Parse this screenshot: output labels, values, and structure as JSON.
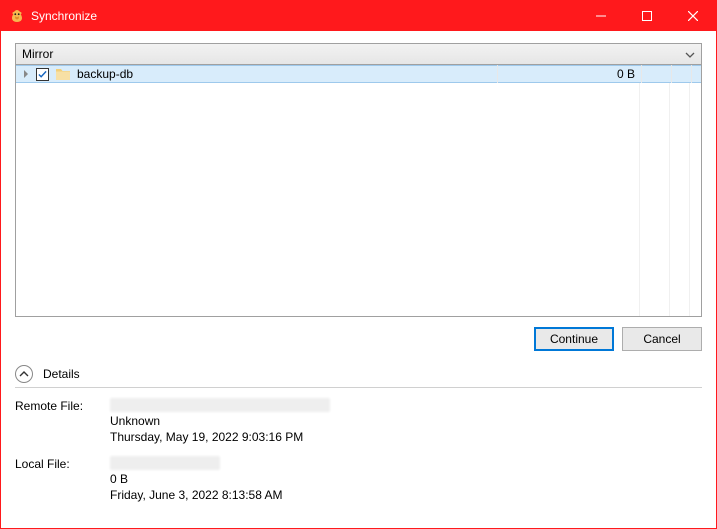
{
  "window": {
    "title": "Synchronize"
  },
  "dropdown": {
    "selected": "Mirror"
  },
  "list": {
    "items": [
      {
        "name": "backup-db",
        "size": "0 B",
        "checked": true,
        "expandable": true
      }
    ]
  },
  "buttons": {
    "continue": "Continue",
    "cancel": "Cancel"
  },
  "details": {
    "header": "Details",
    "remote": {
      "label": "Remote File:",
      "status": "Unknown",
      "timestamp": "Thursday, May 19, 2022 9:03:16 PM"
    },
    "local": {
      "label": "Local File:",
      "size": "0 B",
      "timestamp": "Friday, June 3, 2022 8:13:58 AM"
    }
  }
}
